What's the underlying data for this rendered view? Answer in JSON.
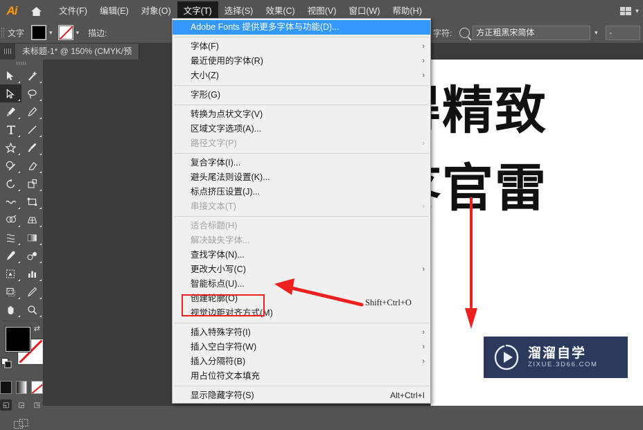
{
  "app": {
    "name": "Adobe Illustrator",
    "logo_text": "Ai",
    "home_icon": "home-icon"
  },
  "menubar": {
    "items": [
      {
        "label": "文件(F)",
        "active": false
      },
      {
        "label": "编辑(E)",
        "active": false
      },
      {
        "label": "对象(O)",
        "active": false
      },
      {
        "label": "文字(T)",
        "active": true
      },
      {
        "label": "选择(S)",
        "active": false
      },
      {
        "label": "效果(C)",
        "active": false
      },
      {
        "label": "视图(V)",
        "active": false
      },
      {
        "label": "窗口(W)",
        "active": false
      },
      {
        "label": "帮助(H)",
        "active": false
      }
    ],
    "workspace_icon": "grid-icon",
    "workspace_chevron": "▾"
  },
  "optionsbar": {
    "tool_label": "文字",
    "fill_swatch": "#000000",
    "fill_chevron": "▾",
    "stroke_swatch": "none",
    "stroke_chevron": "▾",
    "stroke_label": "描边:",
    "character_label": "字符:",
    "search_icon": "search-icon",
    "font_family": "方正粗黑宋简体",
    "font_family_chevron": "▾",
    "font_size": "-",
    "font_size_chevron": "▾",
    "font_size_stepper": "⌃⌄"
  },
  "tabbar": {
    "doc_title": "未标题-1* @ 150% (CMYK/预"
  },
  "toolbar": {
    "tools": [
      {
        "name": "selection-tool",
        "selected": false
      },
      {
        "name": "magic-wand-tool",
        "selected": false
      },
      {
        "name": "direct-selection-tool",
        "selected": true
      },
      {
        "name": "lasso-tool",
        "selected": false
      },
      {
        "name": "pen-tool",
        "selected": false
      },
      {
        "name": "curvature-tool",
        "selected": false
      },
      {
        "name": "type-tool",
        "selected": false
      },
      {
        "name": "line-segment-tool",
        "selected": false
      },
      {
        "name": "shape-tool",
        "selected": false
      },
      {
        "name": "paintbrush-tool",
        "selected": false
      },
      {
        "name": "shaper-tool",
        "selected": false
      },
      {
        "name": "eraser-tool",
        "selected": false
      },
      {
        "name": "rotate-tool",
        "selected": false
      },
      {
        "name": "scale-tool",
        "selected": false
      },
      {
        "name": "width-tool",
        "selected": false
      },
      {
        "name": "free-transform-tool",
        "selected": false
      },
      {
        "name": "shape-builder-tool",
        "selected": false
      },
      {
        "name": "perspective-grid-tool",
        "selected": false
      },
      {
        "name": "mesh-tool",
        "selected": false
      },
      {
        "name": "gradient-tool",
        "selected": false
      },
      {
        "name": "eyedropper-tool",
        "selected": false
      },
      {
        "name": "blend-tool",
        "selected": false
      },
      {
        "name": "symbol-sprayer-tool",
        "selected": false
      },
      {
        "name": "column-graph-tool",
        "selected": false
      },
      {
        "name": "artboard-tool",
        "selected": false
      },
      {
        "name": "slice-tool",
        "selected": false
      },
      {
        "name": "hand-tool",
        "selected": false
      },
      {
        "name": "zoom-tool",
        "selected": false
      }
    ],
    "fill_color": "#000000",
    "stroke_color": "none",
    "swap_icon": "swap-fill-stroke-icon",
    "default_icon": "default-fill-stroke-icon",
    "color_modes": [
      "color",
      "gradient",
      "none"
    ],
    "screen_modes": [
      "normal-screen-mode",
      "full-screen-menubar-mode",
      "full-screen-mode"
    ],
    "edit_toolbar_icon": "edit-toolbar-icon"
  },
  "menu": {
    "title": "文字(T)",
    "items": [
      {
        "label": "Adobe Fonts 提供更多字体与功能(D)...",
        "highlight": true,
        "disabled": false,
        "arrow": false,
        "accel": ""
      },
      {
        "sep": true
      },
      {
        "label": "字体(F)",
        "arrow": true,
        "disabled": false,
        "accel": ""
      },
      {
        "label": "最近使用的字体(R)",
        "arrow": true,
        "disabled": false,
        "accel": ""
      },
      {
        "label": "大小(Z)",
        "arrow": true,
        "disabled": false,
        "accel": ""
      },
      {
        "sep": true
      },
      {
        "label": "字形(G)",
        "arrow": false,
        "disabled": false,
        "accel": ""
      },
      {
        "sep": true
      },
      {
        "label": "转换为点状文字(V)",
        "arrow": false,
        "disabled": false,
        "accel": ""
      },
      {
        "label": "区域文字选项(A)...",
        "arrow": false,
        "disabled": false,
        "accel": ""
      },
      {
        "label": "路径文字(P)",
        "arrow": true,
        "disabled": true,
        "accel": ""
      },
      {
        "sep": true
      },
      {
        "label": "复合字体(I)...",
        "arrow": false,
        "disabled": false,
        "accel": ""
      },
      {
        "label": "避头尾法则设置(K)...",
        "arrow": false,
        "disabled": false,
        "accel": ""
      },
      {
        "label": "标点挤压设置(J)...",
        "arrow": false,
        "disabled": false,
        "accel": ""
      },
      {
        "label": "串接文本(T)",
        "arrow": true,
        "disabled": true,
        "accel": ""
      },
      {
        "sep": true
      },
      {
        "label": "适合标题(H)",
        "arrow": false,
        "disabled": true,
        "accel": ""
      },
      {
        "label": "解决缺失字体...",
        "arrow": false,
        "disabled": true,
        "accel": ""
      },
      {
        "label": "查找字体(N)...",
        "arrow": false,
        "disabled": false,
        "accel": ""
      },
      {
        "label": "更改大小写(C)",
        "arrow": true,
        "disabled": false,
        "accel": ""
      },
      {
        "label": "智能标点(U)...",
        "arrow": false,
        "disabled": false,
        "accel": ""
      },
      {
        "label": "创建轮廓(O)",
        "arrow": false,
        "disabled": false,
        "accel": "",
        "boxed": true
      },
      {
        "label": "视觉边距对齐方式(M)",
        "arrow": false,
        "disabled": false,
        "accel": ""
      },
      {
        "sep": true
      },
      {
        "label": "插入特殊字符(I)",
        "arrow": true,
        "disabled": false,
        "accel": ""
      },
      {
        "label": "插入空白字符(W)",
        "arrow": true,
        "disabled": false,
        "accel": ""
      },
      {
        "label": "插入分隔符(B)",
        "arrow": true,
        "disabled": false,
        "accel": ""
      },
      {
        "label": "用占位符文本填充",
        "arrow": false,
        "disabled": false,
        "accel": ""
      },
      {
        "sep": true
      },
      {
        "label": "显示隐藏字符(S)",
        "arrow": false,
        "disabled": false,
        "accel": "Alt+Ctrl+I"
      }
    ]
  },
  "annotations": {
    "shortcut_text": "Shift+Ctrl+O",
    "arrow_color": "#ee2020",
    "highlight_box_color": "#ee2020"
  },
  "canvas": {
    "artboard_text_line1": "得精致",
    "artboard_text_line2": "疼官雷"
  },
  "watermark": {
    "title": "溜溜自学",
    "subtitle": "ZIXUE.3D66.COM",
    "icon": "play-logo-icon",
    "bg": "#2b3a5c"
  }
}
